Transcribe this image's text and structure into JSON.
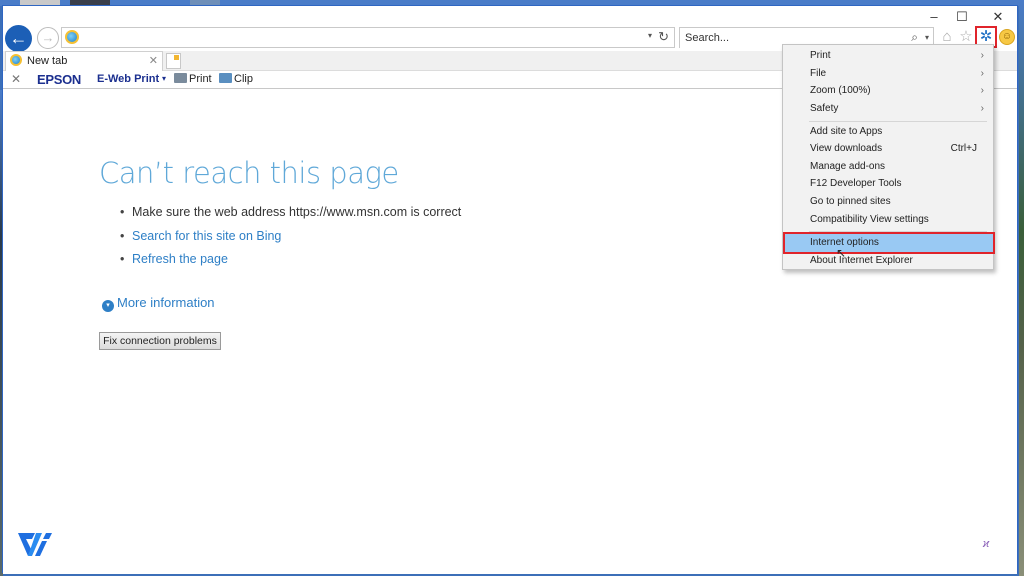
{
  "window": {
    "minimize_label": "–",
    "maximize_label": "☐",
    "close_label": "✕"
  },
  "nav": {
    "back_icon": "←",
    "forward_icon": "→",
    "address_value": "",
    "address_dropdown_icon": "▾",
    "refresh_icon": "↻",
    "search_placeholder": "Search...",
    "search_icon": "⌕",
    "search_dropdown_icon": "▾",
    "home_icon": "⌂",
    "favorites_icon": "☆",
    "tools_icon": "✲",
    "feedback_icon": "☺"
  },
  "tabs": [
    {
      "label": "New tab",
      "close": "✕"
    }
  ],
  "commandbar": {
    "close": "✕",
    "brand": "EPSON",
    "ewebprint": "E-Web Print",
    "ewebprint_dropdown": "▾",
    "print": "Print",
    "clip": "Clip"
  },
  "page": {
    "title": "Can’t reach this page",
    "bullets": [
      "Make sure the web address https://www.msn.com is correct",
      "Search for this site on Bing",
      "Refresh the page"
    ],
    "more_info_icon": "▾",
    "more_info": "More information",
    "fix_button": "Fix connection problems"
  },
  "tools_menu": {
    "items": [
      {
        "label": "Print",
        "arrow": "›"
      },
      {
        "label": "File",
        "arrow": "›"
      },
      {
        "label": "Zoom (100%)",
        "arrow": "›"
      },
      {
        "label": "Safety",
        "arrow": "›"
      },
      {
        "label": "Add site to Apps"
      },
      {
        "label": "View downloads",
        "shortcut": "Ctrl+J"
      },
      {
        "label": "Manage add-ons"
      },
      {
        "label": "F12 Developer Tools"
      },
      {
        "label": "Go to pinned sites"
      },
      {
        "label": "Compatibility View settings"
      },
      {
        "label": "Internet options",
        "highlighted": true
      },
      {
        "label": "About Internet Explorer"
      }
    ]
  },
  "overlay": {
    "cursor_icon": "↖",
    "corner_mark": "ϰ"
  },
  "colors": {
    "accent": "#2e7fc6",
    "title_blue": "#5fa8d8",
    "highlight": "#99c9f3",
    "annotation_red": "#e0242b"
  }
}
